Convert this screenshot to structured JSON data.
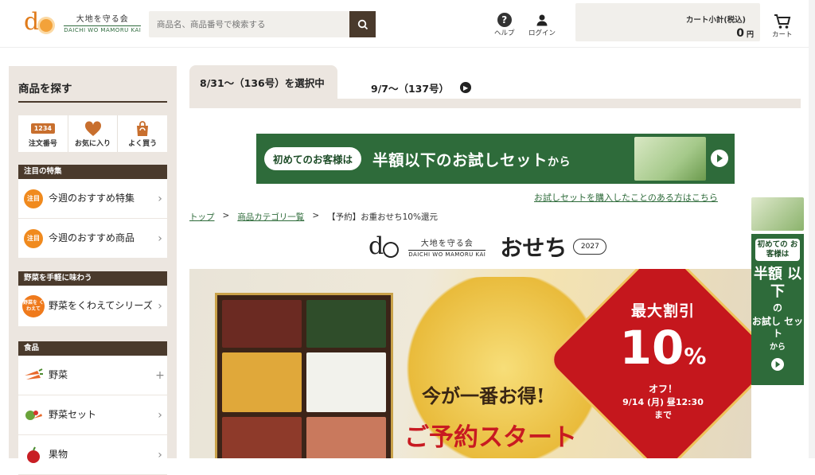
{
  "header": {
    "logo_jp": "大地を守る会",
    "logo_en": "DAICHI WO MAMORU KAI",
    "search_placeholder": "商品名、商品番号で検索する",
    "help_label": "ヘルプ",
    "login_label": "ログイン",
    "cart_subtotal_label": "カート小計(税込)",
    "cart_amount": "0",
    "cart_unit": "円",
    "cart_label": "カート"
  },
  "sidebar": {
    "title": "商品を探す",
    "quick": [
      {
        "icon_text": "1234",
        "label": "注文番号"
      },
      {
        "label": "お気に入り"
      },
      {
        "label": "よく買う"
      }
    ],
    "sections": [
      {
        "heading": "注目の特集",
        "items": [
          {
            "icon_text": "注目",
            "label": "今週のおすすめ特集"
          },
          {
            "icon_text": "注目",
            "label": "今週のおすすめ商品"
          }
        ]
      },
      {
        "heading": "野菜を手軽に味わう",
        "items": [
          {
            "icon_text": "野菜を くわえて",
            "label": "野菜をくわえてシリーズ"
          }
        ]
      },
      {
        "heading": "食品",
        "items": [
          {
            "label": "野菜",
            "arrow": "+"
          },
          {
            "label": "野菜セット",
            "arrow": "›"
          },
          {
            "label": "果物",
            "arrow": "›"
          }
        ]
      }
    ]
  },
  "tabs": [
    {
      "label": "8/31～（136号）を選択中"
    },
    {
      "label": "9/7～（137号）"
    }
  ],
  "banner": {
    "pill": "初めてのお客様は",
    "main": "半額以下のお試しセット",
    "suffix": "から",
    "link": "お試しセットを購入したことのある方はこちら"
  },
  "breadcrumb": [
    "トップ",
    ">",
    "商品カテゴリ一覧",
    ">",
    "【予約】お重おせち10%還元"
  ],
  "osechi": {
    "logo_jp": "大地を守る会",
    "logo_en": "DAICHI WO MAMORU KAI",
    "title": "おせち",
    "year": "2027"
  },
  "hero": {
    "line1": "今が一番お得!",
    "line2": "ご予約スタート",
    "sale_top": "最大割引",
    "sale_num": "10",
    "sale_pct": "%",
    "sale_off": "オフ！",
    "sale_date": "9/14 (月) 昼12:30",
    "sale_until": "まで"
  },
  "side_ad": {
    "pill": "初めての お客様は",
    "big": "半額 以下",
    "small1": "の",
    "small2": "お試し セット",
    "small3": "から"
  },
  "colors": {
    "brand_green": "#2e6b3a",
    "brand_brown": "#4a3a2c",
    "sale_red": "#c5171d"
  }
}
